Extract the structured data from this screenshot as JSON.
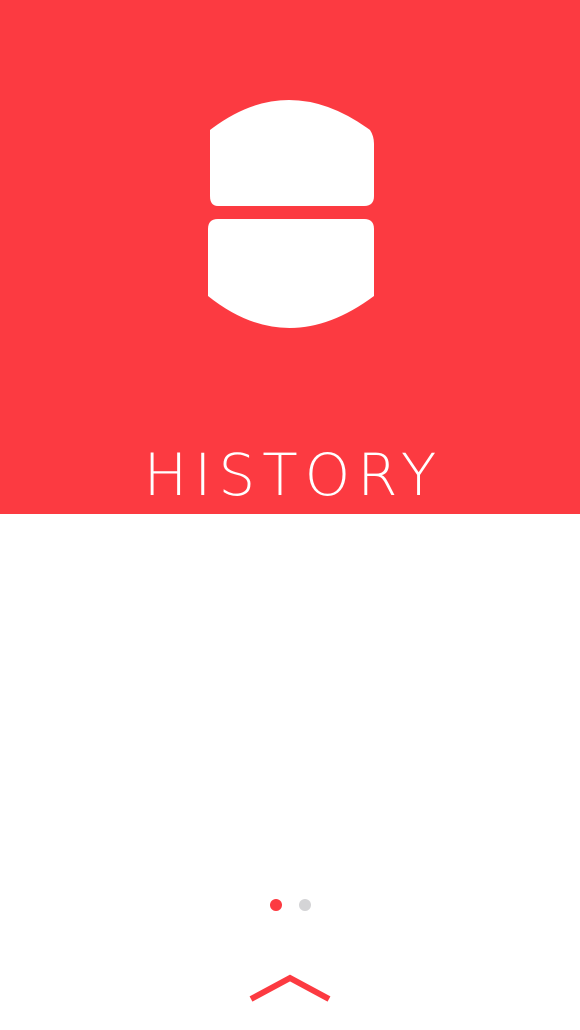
{
  "hero": {
    "title": "HISTORY",
    "icon": "history-book-icon",
    "background_color": "#fc3a41"
  },
  "pager": {
    "page_count": 2,
    "current_page": 1,
    "active_color": "#fc3a41",
    "inactive_color": "#d4d4d6"
  },
  "swipe_up": {
    "icon": "chevron-up-icon",
    "color": "#fc3a41"
  }
}
